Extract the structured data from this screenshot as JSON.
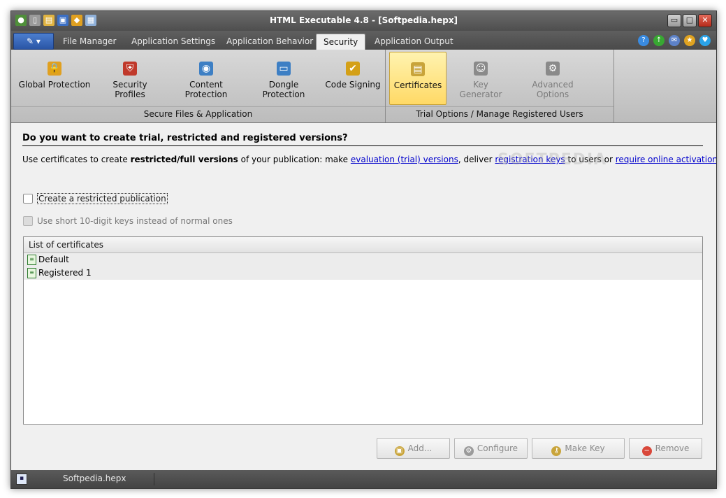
{
  "window": {
    "title": "HTML Executable 4.8 - [Softpedia.hepx]",
    "controls": {
      "minimize": "▭",
      "maximize": "□",
      "close": "✕"
    }
  },
  "quick_access": [
    {
      "icon": "globe-icon",
      "glyph": "●",
      "color": "#4f8f3a"
    },
    {
      "icon": "new-file-icon",
      "glyph": "▯",
      "color": "#cfcfcf"
    },
    {
      "icon": "open-folder-icon",
      "glyph": "▤",
      "color": "#e0b341"
    },
    {
      "icon": "save-icon",
      "glyph": "▣",
      "color": "#3b6fc4"
    },
    {
      "icon": "build-icon",
      "glyph": "◆",
      "color": "#e0a020"
    },
    {
      "icon": "preview-icon",
      "glyph": "▦",
      "color": "#8fb0d8"
    }
  ],
  "menu": {
    "app_button_glyph": "✎ ▾",
    "tabs": [
      "File Manager",
      "Application Settings",
      "Application Behavior",
      "Security",
      "Application Output"
    ],
    "active_tab": "Security"
  },
  "help_icons": [
    {
      "icon": "help-icon",
      "glyph": "?",
      "color": "#3a8be0"
    },
    {
      "icon": "update-arrow-icon",
      "glyph": "↑",
      "color": "#38a832"
    },
    {
      "icon": "tools-icon",
      "glyph": "✉",
      "color": "#5d82c8"
    },
    {
      "icon": "award-icon",
      "glyph": "★",
      "color": "#e0a320"
    },
    {
      "icon": "twitter-icon",
      "glyph": "♥",
      "color": "#2aa3e8"
    }
  ],
  "ribbon": {
    "group1": {
      "label": "Secure Files & Application",
      "buttons": [
        {
          "label": "Global Protection",
          "icon": "padlock-icon",
          "glyph": "🔒",
          "color": "#e0a020"
        },
        {
          "label": "Security Profiles",
          "icon": "shield-icon",
          "glyph": "⛨",
          "color": "#c0392b"
        },
        {
          "label": "Content Protection",
          "icon": "eye-shield-icon",
          "glyph": "◉",
          "color": "#3d7fc4"
        },
        {
          "label": "Dongle Protection",
          "icon": "usb-key-icon",
          "glyph": "▭",
          "color": "#3d7fc4"
        },
        {
          "label": "Code Signing",
          "icon": "certificate-icon",
          "glyph": "✔",
          "color": "#d4a017"
        }
      ]
    },
    "group2": {
      "label": "Trial Options / Manage Registered Users",
      "buttons": [
        {
          "label": "Certificates",
          "icon": "certificates-icon",
          "glyph": "▤",
          "color": "#c9a43a",
          "state": "active"
        },
        {
          "label": "Key Generator",
          "icon": "key-generator-icon",
          "glyph": "☺",
          "color": "#8a8a8a",
          "state": "disabled"
        },
        {
          "label": "Advanced Options",
          "icon": "advanced-options-icon",
          "glyph": "⚙",
          "color": "#8a8a8a",
          "state": "disabled"
        }
      ]
    }
  },
  "content": {
    "heading": "Do you want to create trial, restricted and registered versions?",
    "desc": {
      "t1": "Use certificates to create ",
      "b1": "restricted/full versions",
      "t2": " of your publication: make ",
      "link1": "evaluation (trial) versions",
      "t3": ", deliver ",
      "link2": "registration keys",
      "t4": " to users or ",
      "link3": "require online activation",
      "t5": "..."
    },
    "watermark": "SOFTPEDIA",
    "checkbox_restricted": "Create a restricted publication",
    "checkbox_shortkeys": "Use short 10-digit keys instead of normal ones",
    "list": {
      "header": "List of certificates",
      "items": [
        "Default",
        "Registered 1"
      ]
    },
    "buttons": {
      "add": "Add...",
      "configure": "Configure",
      "make_key": "Make Key",
      "remove": "Remove"
    }
  },
  "status": {
    "file": "Softpedia.hepx"
  }
}
